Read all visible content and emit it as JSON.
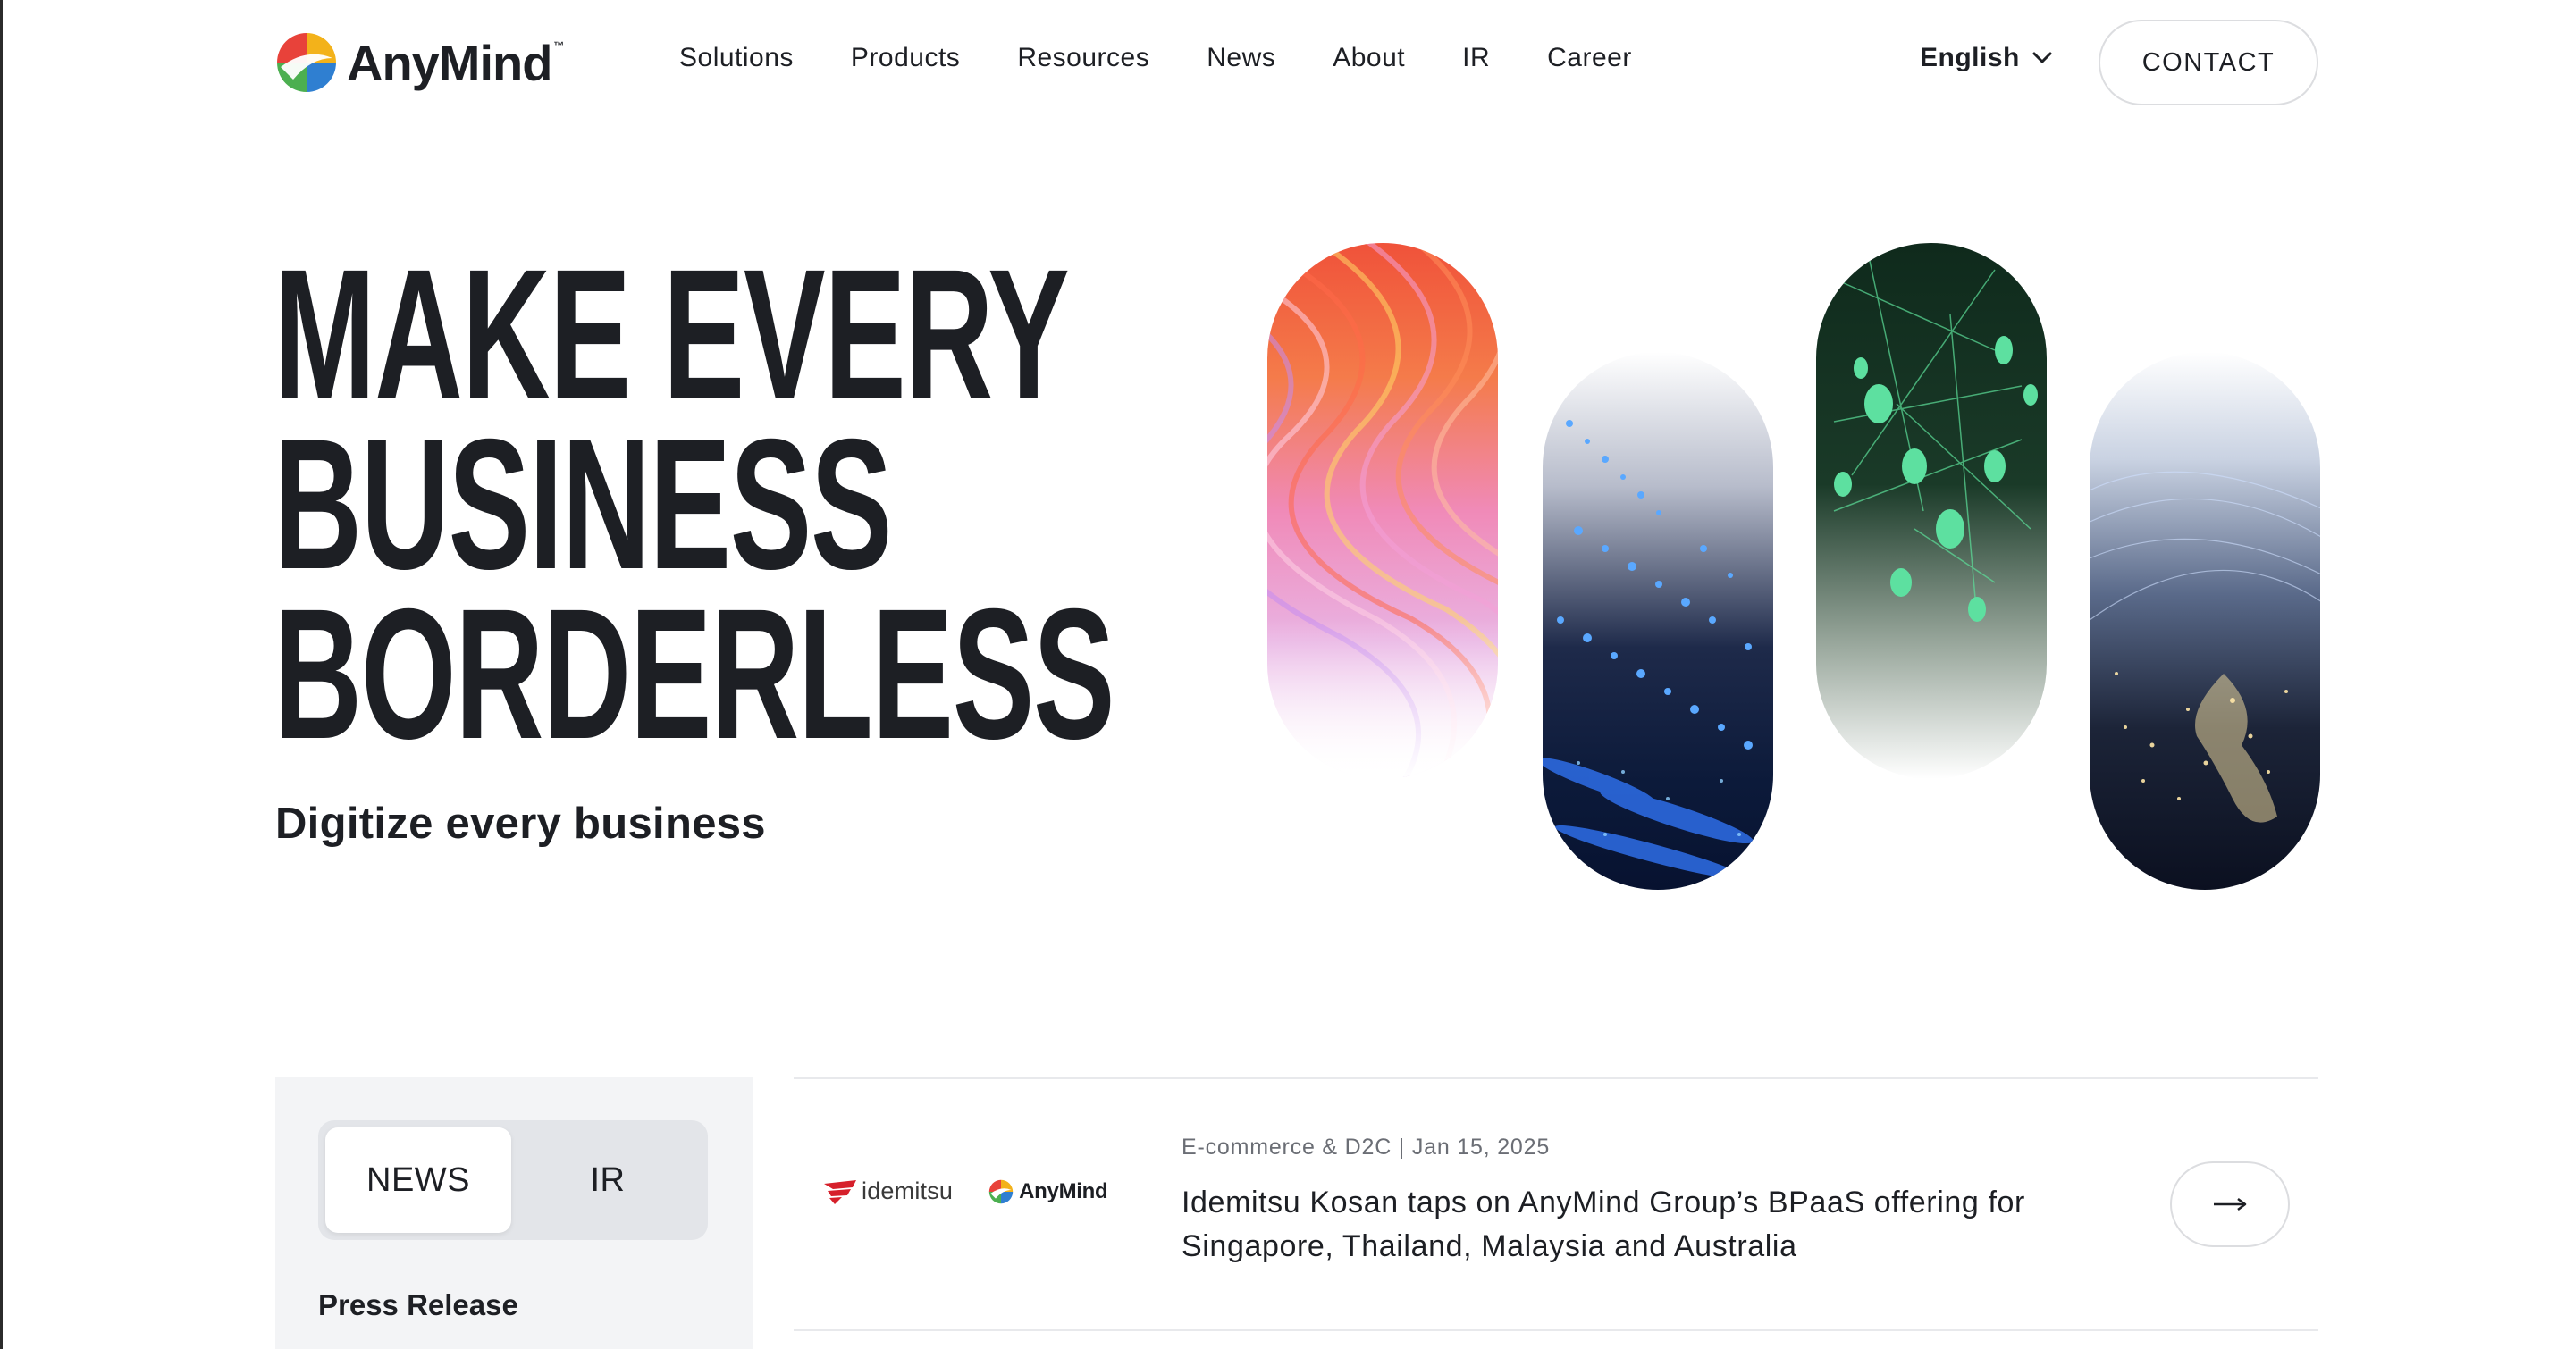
{
  "brand": {
    "name": "AnyMind",
    "tm": "™"
  },
  "nav": {
    "items": [
      {
        "label": "Solutions"
      },
      {
        "label": "Products"
      },
      {
        "label": "Resources"
      },
      {
        "label": "News"
      },
      {
        "label": "About"
      },
      {
        "label": "IR"
      },
      {
        "label": "Career"
      }
    ],
    "language": "English",
    "contact": "CONTACT"
  },
  "hero": {
    "title_lines": [
      "MAKE EVERY",
      "BUSINESS",
      "BORDERLESS"
    ],
    "subtitle": "Digitize every business"
  },
  "news_panel": {
    "tabs": [
      {
        "label": "NEWS",
        "active": true
      },
      {
        "label": "IR",
        "active": false
      }
    ],
    "category_label": "Press Release"
  },
  "news_items": [
    {
      "partner_logo": "idemitsu",
      "brand_logo": "AnyMind",
      "meta": "E-commerce & D2C | Jan 15, 2025",
      "title": "Idemitsu Kosan taps on AnyMind Group’s BPaaS offering for Singapore, Thailand, Malaysia and Australia",
      "arrow_icon": "arrow-right-icon"
    }
  ],
  "colors": {
    "text": "#1d1f24",
    "panel_bg": "#f3f4f6",
    "tab_track": "#e3e5e9",
    "border": "#dcdde0",
    "meta": "#6b6e75",
    "idemitsu_red": "#d6202b"
  }
}
